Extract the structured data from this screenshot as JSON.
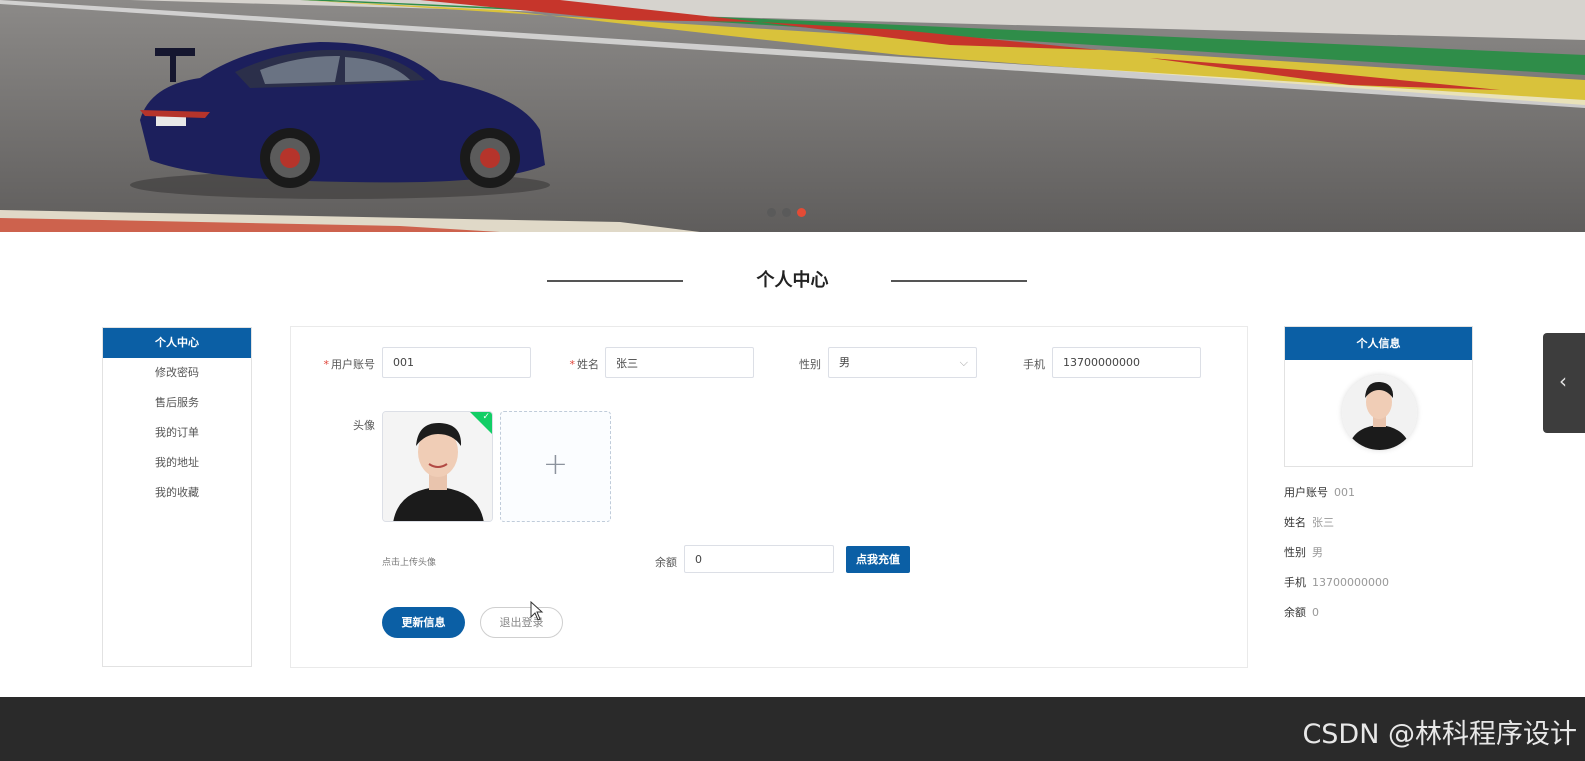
{
  "banner": {
    "dots": 3,
    "active_dot_index": 2
  },
  "section_title": "个人中心",
  "menu": {
    "items": [
      {
        "label": "个人中心",
        "active": true
      },
      {
        "label": "修改密码",
        "active": false
      },
      {
        "label": "售后服务",
        "active": false
      },
      {
        "label": "我的订单",
        "active": false
      },
      {
        "label": "我的地址",
        "active": false
      },
      {
        "label": "我的收藏",
        "active": false
      }
    ]
  },
  "form": {
    "account_label": "用户账号",
    "account_value": "001",
    "name_label": "姓名",
    "name_value": "张三",
    "gender_label": "性别",
    "gender_value": "男",
    "phone_label": "手机",
    "phone_value": "13700000000",
    "avatar_label": "头像",
    "upload_hint": "点击上传头像",
    "balance_label": "余额",
    "balance_value": "0",
    "charge_button": "点我充值",
    "update_button": "更新信息",
    "logout_button": "退出登录",
    "required_mark": "*"
  },
  "info_card": {
    "title": "个人信息",
    "rows": [
      {
        "label": "用户账号",
        "value": "001"
      },
      {
        "label": "姓名",
        "value": "张三"
      },
      {
        "label": "性别",
        "value": "男"
      },
      {
        "label": "手机",
        "value": "13700000000"
      },
      {
        "label": "余额",
        "value": "0"
      }
    ]
  },
  "side_tab": {
    "icon": "chevron-left-icon",
    "glyph": "‹"
  },
  "watermark": "CSDN @林科程序设计",
  "colors": {
    "primary": "#0b5fa5",
    "active_dot": "#e44b35",
    "success": "#13ce66",
    "footer": "#2a2a2a"
  }
}
